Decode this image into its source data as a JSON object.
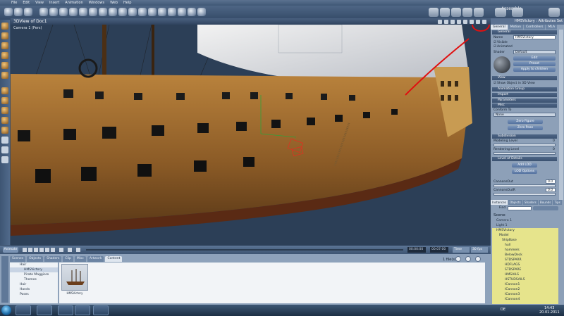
{
  "menu": [
    "File",
    "Edit",
    "View",
    "Insert",
    "Animation",
    "Windows",
    "Web",
    "Help"
  ],
  "toolbar": {
    "assemble_label": "Assemble"
  },
  "viewport": {
    "title": "3DView of Doc1",
    "camera_label": "Camera 1 (Pers)"
  },
  "timeline": {
    "anim_label": "Animate",
    "frame_start": "00:00:00",
    "frame_end": "00:07:00",
    "time_mode": "Time",
    "fps": "30 fps"
  },
  "content": {
    "tabs": [
      "Scenes",
      "Objects",
      "Shaders",
      "Clip",
      "Misc",
      "Artwork",
      "Content"
    ],
    "active_tab": "Content",
    "tree": [
      "Hair",
      "HMSVictory",
      "Pirate Maggiore",
      "Themes",
      "Hair",
      "Hands",
      "Poses"
    ],
    "thumbnail_label": "HMSVictory",
    "items_count": "1 file(s)"
  },
  "attributes": {
    "header": "HMSVictory : Attributes Set",
    "tabs": [
      "General",
      "Motion",
      "Controllers",
      "MLA"
    ],
    "active_tab": "General",
    "general_label": "General",
    "name_label": "Name",
    "name_value": "HMSVictory",
    "visible_label": "Visible",
    "animated_label": "Animated",
    "shader_label": "Shader",
    "shader_value": "Default",
    "edit_button": "Edit",
    "preset_button": "Preset",
    "apply_children_button": "Apply to children",
    "view_section": "View",
    "show_in_3d_label": "Show Object in 3D View",
    "animation_group_section": "Animation Group",
    "import_section": "Import",
    "parameters_section": "Parameters",
    "misc_section": "Misc",
    "conform_to_label": "Conform To",
    "conform_to_value": "None",
    "zero_figure_button": "Zero Figure",
    "zero_pose_button": "Zero Pose",
    "subdivision_section": "Subdivision",
    "modeling_level_label": "Modeling Level",
    "modeling_level_value": "0",
    "rendering_level_label": "Rendering Level",
    "rendering_level_value": "0",
    "lod_section": "Level of Details",
    "add_lod_button": "Add LOD",
    "lod_options_button": "LOD Options",
    "cannons_out_label": "CannonsOut",
    "cannons_out_value": "0.0",
    "cannons_left_label": "CannonsOutR",
    "cannons_left_value": "0.0"
  },
  "scene_panel": {
    "tabs": [
      "Instances",
      "Objects",
      "Shaders",
      "Bounds",
      "Tips"
    ],
    "active_tab": "Instances",
    "find_label": "Find",
    "title": "Scene",
    "items": [
      "Camera 1",
      "Light 1",
      "HMSVictory",
      "Model",
      "ShipBase",
      "hull",
      "hammels",
      "BelowDeck",
      "STDSPARR",
      "HDFLAGS",
      "STDSPARE",
      "HMSAILS",
      "HSTUDSAILS",
      "ICannon1",
      "ICannon2",
      "ICannon3",
      "ICannon4"
    ]
  },
  "taskbar": {
    "lang": "DE",
    "time": "14:43",
    "date": "20.01.2011"
  },
  "colors": {
    "highlight_scene_row": "#e6e48c",
    "annotation_red": "#e01010",
    "viewport_bg": "#2d4058"
  }
}
